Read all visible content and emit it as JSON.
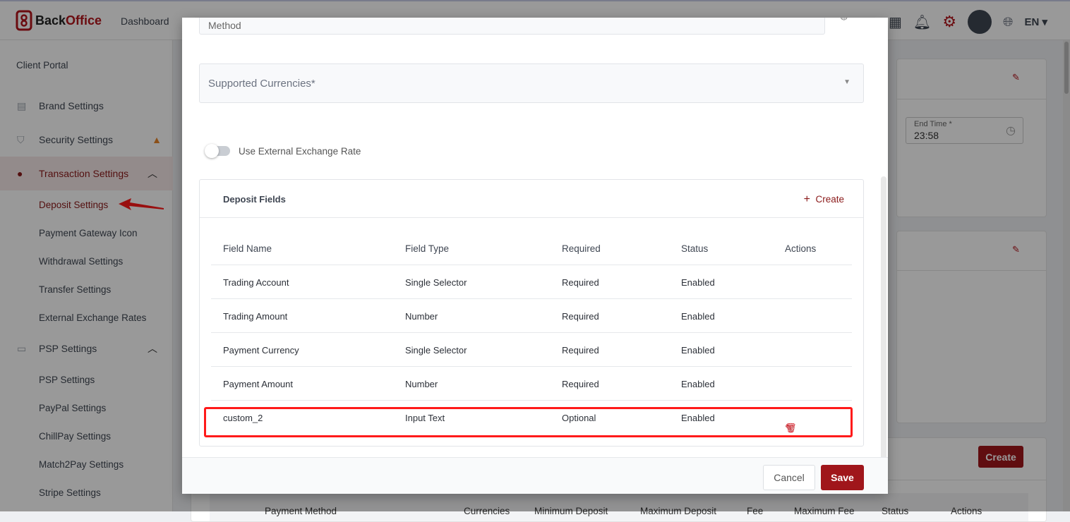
{
  "header": {
    "brand_a": "Back",
    "brand_b": "Office",
    "nav_dashboard": "Dashboard",
    "lang": "EN"
  },
  "sidebar": {
    "client_portal": "Client Portal",
    "items": [
      {
        "label": "Brand Settings"
      },
      {
        "label": "Security Settings"
      },
      {
        "label": "Transaction Settings"
      },
      {
        "label": "PSP Settings"
      }
    ],
    "transaction_sub": [
      "Deposit Settings",
      "Payment Gateway Icon",
      "Withdrawal Settings",
      "Transfer Settings",
      "External Exchange Rates"
    ],
    "psp_sub": [
      "PSP Settings",
      "PayPal Settings",
      "ChillPay Settings",
      "Match2Pay Settings",
      "Stripe Settings"
    ]
  },
  "background": {
    "end_time_label": "End Time *",
    "end_time_value": "23:58",
    "create_label": "Create",
    "table_headers": [
      "Payment Method",
      "Currencies",
      "Minimum Deposit",
      "Maximum Deposit",
      "Fee",
      "Maximum Fee",
      "Status",
      "Actions"
    ]
  },
  "modal": {
    "method_label": "Method",
    "currencies_placeholder": "Supported Currencies*",
    "external_rate_label": "Use External Exchange Rate",
    "external_rate_on": false,
    "deposit_fields": {
      "title": "Deposit Fields",
      "create_label": "Create",
      "headers": [
        "Field Name",
        "Field Type",
        "Required",
        "Status",
        "Actions"
      ],
      "rows": [
        [
          "Trading Account",
          "Single Selector",
          "Required",
          "Enabled"
        ],
        [
          "Trading Amount",
          "Number",
          "Required",
          "Enabled"
        ],
        [
          "Payment Currency",
          "Single Selector",
          "Required",
          "Enabled"
        ],
        [
          "Payment Amount",
          "Number",
          "Required",
          "Enabled"
        ],
        [
          "custom_2",
          "Input Text",
          "Optional",
          "Enabled"
        ]
      ]
    },
    "cancel_label": "Cancel",
    "save_label": "Save"
  },
  "colors": {
    "brand": "#b3141c",
    "save": "#a0161b",
    "highlight": "#ff1a1a"
  }
}
